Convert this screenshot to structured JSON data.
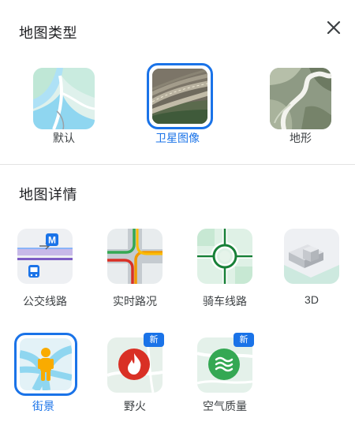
{
  "map_types": {
    "title": "地图类型",
    "items": [
      {
        "label": "默认",
        "selected": false
      },
      {
        "label": "卫星图像",
        "selected": true
      },
      {
        "label": "地形",
        "selected": false
      }
    ]
  },
  "map_details": {
    "title": "地图详情",
    "items": [
      {
        "label": "公交线路",
        "selected": false,
        "icon": "transit-icon"
      },
      {
        "label": "实时路况",
        "selected": false,
        "icon": "traffic-icon"
      },
      {
        "label": "骑车线路",
        "selected": false,
        "icon": "biking-icon"
      },
      {
        "label": "3D",
        "selected": false,
        "icon": "3d-buildings-icon"
      },
      {
        "label": "街景",
        "selected": true,
        "icon": "street-view-icon"
      },
      {
        "label": "野火",
        "selected": false,
        "icon": "wildfire-icon",
        "badge": "新"
      },
      {
        "label": "空气质量",
        "selected": false,
        "icon": "air-quality-icon",
        "badge": "新"
      }
    ]
  },
  "transit_badge": "M",
  "colors": {
    "accent": "#1a73e8",
    "text": "#202124",
    "fire": "#d93025",
    "air": "#34a853"
  }
}
